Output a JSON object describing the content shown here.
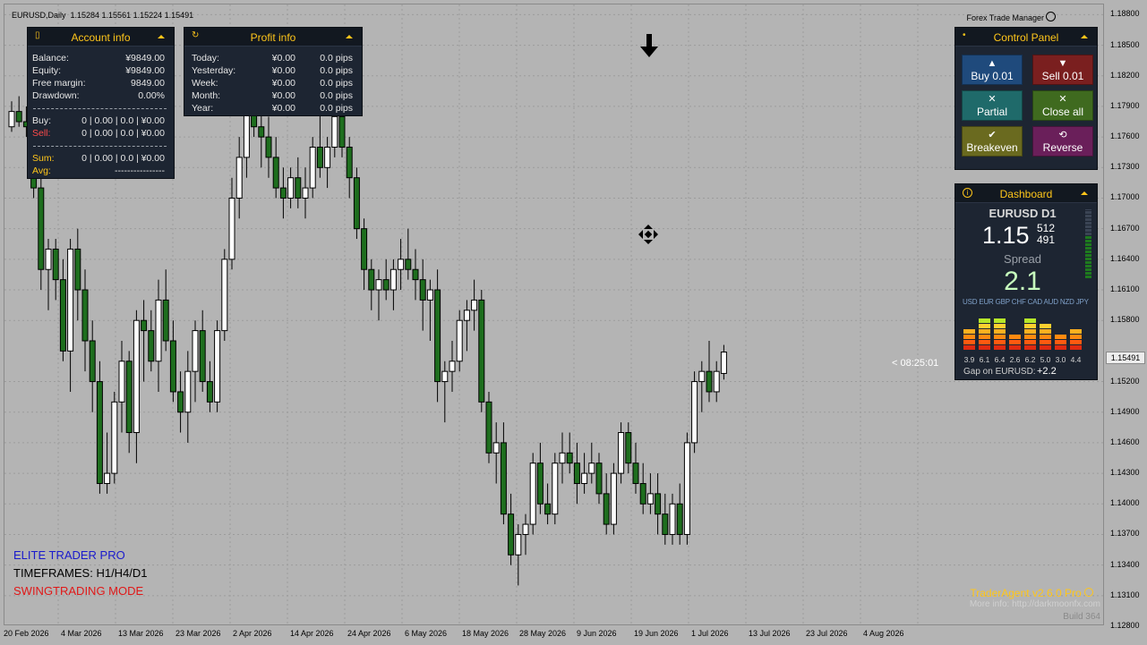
{
  "header": {
    "symbol_line": "EURUSD,Daily  1.15284 1.15561 1.15224 1.15491",
    "trade_manager": "Forex Trade Manager"
  },
  "price_axis": [
    "1.18800",
    "1.18500",
    "1.18200",
    "1.17900",
    "1.17600",
    "1.17300",
    "1.17000",
    "1.16700",
    "1.16400",
    "1.16100",
    "1.15800",
    "1.15200",
    "1.14900",
    "1.14600",
    "1.14300",
    "1.14000",
    "1.13700",
    "1.13400",
    "1.13100",
    "1.12800"
  ],
  "current_price": "1.15491",
  "date_axis": [
    "20 Feb 2026",
    "4 Mar 2026",
    "13 Mar 2026",
    "23 Mar 2026",
    "2 Apr 2026",
    "14 Apr 2026",
    "24 Apr 2026",
    "6 May 2026",
    "18 May 2026",
    "28 May 2026",
    "9 Jun 2026",
    "19 Jun 2026",
    "1 Jul 2026",
    "13 Jul 2026",
    "23 Jul 2026",
    "4 Aug 2026"
  ],
  "account": {
    "title": "Account info",
    "rows": [
      {
        "label": "Balance:",
        "value": "¥9849.00"
      },
      {
        "label": "Equity:",
        "value": "¥9849.00"
      },
      {
        "label": "Free margin:",
        "value": "9849.00"
      },
      {
        "label": "Drawdown:",
        "value": "0.00%"
      }
    ],
    "buy_label": "Buy:",
    "buy_value": "0 | 0.00 | 0.0 | ¥0.00",
    "sell_label": "Sell:",
    "sell_value": "0 | 0.00 | 0.0 | ¥0.00",
    "sum_label": "Sum:",
    "sum_value": "0 | 0.00 | 0.0 | ¥0.00",
    "avg_label": "Avg:",
    "avg_value": "----------------"
  },
  "profit": {
    "title": "Profit info",
    "rows": [
      {
        "label": "Today:",
        "money": "¥0.00",
        "pips": "0.0 pips"
      },
      {
        "label": "Yesterday:",
        "money": "¥0.00",
        "pips": "0.0 pips"
      },
      {
        "label": "Week:",
        "money": "¥0.00",
        "pips": "0.0 pips"
      },
      {
        "label": "Month:",
        "money": "¥0.00",
        "pips": "0.0 pips"
      },
      {
        "label": "Year:",
        "money": "¥0.00",
        "pips": "0.0 pips"
      }
    ]
  },
  "control": {
    "title": "Control Panel",
    "buttons": [
      {
        "label": "Buy 0.01",
        "glyph": "▲",
        "color": "#1f4a7c"
      },
      {
        "label": "Sell 0.01",
        "glyph": "▼",
        "color": "#7a1f1f"
      },
      {
        "label": "Partial",
        "glyph": "✕",
        "color": "#1f6a6a"
      },
      {
        "label": "Close all",
        "glyph": "✕",
        "color": "#3f6a1f"
      },
      {
        "label": "Breakeven",
        "glyph": "✔",
        "color": "#6a6a1f"
      },
      {
        "label": "Reverse",
        "glyph": "⟲",
        "color": "#6a1f5a"
      }
    ]
  },
  "dashboard": {
    "title": "Dashboard",
    "symbol": "EURUSD D1",
    "price_main": "1.15",
    "price_frac_top": "512",
    "price_frac_bottom": "491",
    "spread_label": "Spread",
    "spread_value": "2.1",
    "currencies": "USD EUR GBP CHF CAD AUD NZD JPY",
    "strengths": [
      3.9,
      6.1,
      6.4,
      2.6,
      6.2,
      5.0,
      3.0,
      4.4
    ],
    "strength_labels": [
      "3.9",
      "6.1",
      "6.4",
      "2.6",
      "6.2",
      "5.0",
      "3.0",
      "4.4"
    ],
    "gap_label": "Gap on EURUSD:",
    "gap_value": "+2.2"
  },
  "countdown": "< 08:25:01",
  "overlay": {
    "line1": "ELITE TRADER PRO",
    "line2": "TIMEFRAMES: H1/H4/D1",
    "line3": "SWINGTRADING MODE"
  },
  "brand": {
    "name": "TraderAgent v2.6.0 Pro",
    "info": "More info: http://darkmoonfx.com",
    "build": "Build 364"
  },
  "chart_data": {
    "type": "candlestick",
    "symbol": "EURUSD",
    "timeframe": "Daily",
    "ylim": [
      1.128,
      1.189
    ],
    "candles": [
      [
        1.177,
        1.1795,
        1.1765,
        1.1785
      ],
      [
        1.1785,
        1.18,
        1.177,
        1.1775
      ],
      [
        1.1775,
        1.179,
        1.176,
        1.177
      ],
      [
        1.177,
        1.179,
        1.17,
        1.171
      ],
      [
        1.171,
        1.172,
        1.161,
        1.163
      ],
      [
        1.163,
        1.166,
        1.159,
        1.165
      ],
      [
        1.165,
        1.166,
        1.16,
        1.162
      ],
      [
        1.162,
        1.164,
        1.154,
        1.155
      ],
      [
        1.155,
        1.166,
        1.151,
        1.165
      ],
      [
        1.165,
        1.167,
        1.158,
        1.161
      ],
      [
        1.161,
        1.163,
        1.153,
        1.156
      ],
      [
        1.156,
        1.158,
        1.149,
        1.152
      ],
      [
        1.152,
        1.154,
        1.141,
        1.142
      ],
      [
        1.142,
        1.147,
        1.141,
        1.143
      ],
      [
        1.143,
        1.151,
        1.142,
        1.15
      ],
      [
        1.15,
        1.156,
        1.147,
        1.154
      ],
      [
        1.154,
        1.155,
        1.145,
        1.147
      ],
      [
        1.147,
        1.159,
        1.144,
        1.158
      ],
      [
        1.158,
        1.16,
        1.152,
        1.157
      ],
      [
        1.157,
        1.159,
        1.153,
        1.154
      ],
      [
        1.154,
        1.162,
        1.151,
        1.16
      ],
      [
        1.16,
        1.163,
        1.155,
        1.156
      ],
      [
        1.156,
        1.158,
        1.15,
        1.151
      ],
      [
        1.151,
        1.153,
        1.147,
        1.149
      ],
      [
        1.149,
        1.155,
        1.146,
        1.153
      ],
      [
        1.153,
        1.158,
        1.15,
        1.157
      ],
      [
        1.157,
        1.159,
        1.151,
        1.152
      ],
      [
        1.152,
        1.154,
        1.149,
        1.15
      ],
      [
        1.15,
        1.158,
        1.149,
        1.157
      ],
      [
        1.157,
        1.165,
        1.156,
        1.164
      ],
      [
        1.164,
        1.172,
        1.163,
        1.17
      ],
      [
        1.17,
        1.176,
        1.168,
        1.174
      ],
      [
        1.174,
        1.18,
        1.172,
        1.179
      ],
      [
        1.179,
        1.181,
        1.176,
        1.177
      ],
      [
        1.177,
        1.179,
        1.173,
        1.176
      ],
      [
        1.176,
        1.178,
        1.172,
        1.174
      ],
      [
        1.174,
        1.176,
        1.17,
        1.171
      ],
      [
        1.171,
        1.173,
        1.168,
        1.17
      ],
      [
        1.17,
        1.173,
        1.169,
        1.172
      ],
      [
        1.172,
        1.174,
        1.169,
        1.17
      ],
      [
        1.17,
        1.173,
        1.168,
        1.171
      ],
      [
        1.171,
        1.176,
        1.17,
        1.175
      ],
      [
        1.175,
        1.179,
        1.172,
        1.173
      ],
      [
        1.173,
        1.176,
        1.171,
        1.175
      ],
      [
        1.175,
        1.179,
        1.174,
        1.178
      ],
      [
        1.178,
        1.179,
        1.174,
        1.175
      ],
      [
        1.175,
        1.176,
        1.17,
        1.172
      ],
      [
        1.172,
        1.173,
        1.166,
        1.167
      ],
      [
        1.167,
        1.168,
        1.161,
        1.163
      ],
      [
        1.163,
        1.164,
        1.159,
        1.161
      ],
      [
        1.161,
        1.163,
        1.158,
        1.162
      ],
      [
        1.162,
        1.164,
        1.16,
        1.161
      ],
      [
        1.161,
        1.164,
        1.159,
        1.163
      ],
      [
        1.163,
        1.166,
        1.161,
        1.164
      ],
      [
        1.164,
        1.167,
        1.162,
        1.163
      ],
      [
        1.163,
        1.165,
        1.16,
        1.162
      ],
      [
        1.162,
        1.164,
        1.157,
        1.16
      ],
      [
        1.16,
        1.162,
        1.156,
        1.161
      ],
      [
        1.161,
        1.163,
        1.15,
        1.152
      ],
      [
        1.152,
        1.154,
        1.148,
        1.153
      ],
      [
        1.153,
        1.156,
        1.151,
        1.154
      ],
      [
        1.154,
        1.159,
        1.153,
        1.158
      ],
      [
        1.158,
        1.16,
        1.155,
        1.159
      ],
      [
        1.159,
        1.162,
        1.157,
        1.16
      ],
      [
        1.16,
        1.161,
        1.149,
        1.15
      ],
      [
        1.15,
        1.151,
        1.144,
        1.145
      ],
      [
        1.145,
        1.148,
        1.142,
        1.146
      ],
      [
        1.146,
        1.148,
        1.138,
        1.139
      ],
      [
        1.139,
        1.141,
        1.134,
        1.135
      ],
      [
        1.135,
        1.138,
        1.132,
        1.137
      ],
      [
        1.137,
        1.139,
        1.135,
        1.138
      ],
      [
        1.138,
        1.145,
        1.137,
        1.144
      ],
      [
        1.144,
        1.146,
        1.139,
        1.14
      ],
      [
        1.14,
        1.142,
        1.138,
        1.139
      ],
      [
        1.139,
        1.145,
        1.138,
        1.144
      ],
      [
        1.144,
        1.147,
        1.142,
        1.145
      ],
      [
        1.145,
        1.147,
        1.143,
        1.144
      ],
      [
        1.144,
        1.146,
        1.14,
        1.142
      ],
      [
        1.142,
        1.145,
        1.141,
        1.143
      ],
      [
        1.143,
        1.146,
        1.142,
        1.144
      ],
      [
        1.144,
        1.145,
        1.14,
        1.141
      ],
      [
        1.141,
        1.143,
        1.137,
        1.138
      ],
      [
        1.138,
        1.144,
        1.137,
        1.143
      ],
      [
        1.143,
        1.148,
        1.142,
        1.147
      ],
      [
        1.147,
        1.148,
        1.143,
        1.144
      ],
      [
        1.144,
        1.146,
        1.141,
        1.142
      ],
      [
        1.142,
        1.144,
        1.139,
        1.14
      ],
      [
        1.14,
        1.143,
        1.139,
        1.141
      ],
      [
        1.141,
        1.143,
        1.137,
        1.139
      ],
      [
        1.139,
        1.141,
        1.136,
        1.137
      ],
      [
        1.137,
        1.141,
        1.136,
        1.14
      ],
      [
        1.14,
        1.142,
        1.136,
        1.137
      ],
      [
        1.137,
        1.147,
        1.136,
        1.146
      ],
      [
        1.146,
        1.153,
        1.145,
        1.152
      ],
      [
        1.152,
        1.154,
        1.149,
        1.153
      ],
      [
        1.153,
        1.156,
        1.15,
        1.151
      ],
      [
        1.151,
        1.154,
        1.15,
        1.153
      ],
      [
        1.1528,
        1.1556,
        1.1522,
        1.1549
      ]
    ]
  }
}
